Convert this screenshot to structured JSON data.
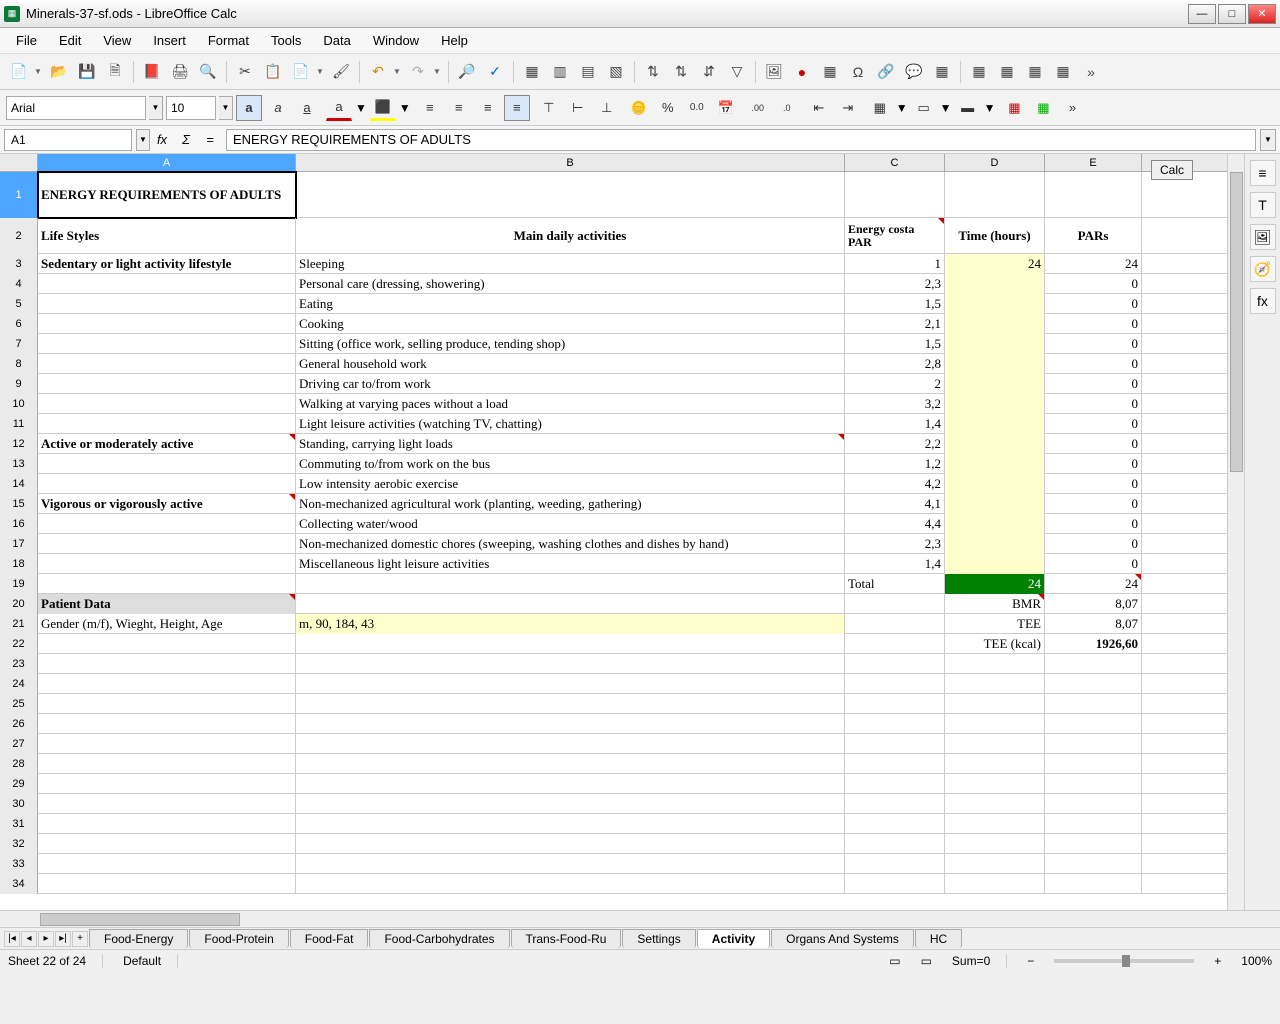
{
  "window": {
    "title": "Minerals-37-sf.ods - LibreOffice Calc"
  },
  "menu": [
    "File",
    "Edit",
    "View",
    "Insert",
    "Format",
    "Tools",
    "Data",
    "Window",
    "Help"
  ],
  "format": {
    "font_name": "Arial",
    "font_size": "10"
  },
  "cellref": {
    "name": "A1",
    "formula": "ENERGY REQUIREMENTS OF ADULTS"
  },
  "columns": [
    "A",
    "B",
    "C",
    "D",
    "E"
  ],
  "calc_button": "Calc",
  "rows": [
    {
      "n": 1,
      "h": "row1",
      "A": "ENERGY REQUIREMENTS OF ADULTS",
      "A_bold": true,
      "A_sel": true
    },
    {
      "n": 2,
      "h": "row2",
      "A": "Life Styles",
      "A_bold": true,
      "B": "Main daily activities",
      "B_bold": true,
      "B_center": true,
      "C": "Energy costa PAR",
      "C_bold": true,
      "C_center": true,
      "C_red": true,
      "D": "Time (hours)",
      "D_bold": true,
      "D_center": true,
      "E": "PARs",
      "E_bold": true,
      "E_center": true
    },
    {
      "n": 3,
      "A": "Sedentary or light activity lifestyle",
      "A_bold": true,
      "B": "Sleeping",
      "C": "1",
      "D": "24",
      "D_yellow": true,
      "E": "24"
    },
    {
      "n": 4,
      "B": "Personal care (dressing, showering)",
      "C": "2,3",
      "D": "",
      "D_yellow": true,
      "E": "0"
    },
    {
      "n": 5,
      "B": "Eating",
      "C": "1,5",
      "D": "",
      "D_yellow": true,
      "E": "0"
    },
    {
      "n": 6,
      "B": "Cooking",
      "C": "2,1",
      "D": "",
      "D_yellow": true,
      "E": "0"
    },
    {
      "n": 7,
      "B": "Sitting (office work, selling produce, tending shop)",
      "C": "1,5",
      "D": "",
      "D_yellow": true,
      "E": "0"
    },
    {
      "n": 8,
      "B": "General household work",
      "C": "2,8",
      "D": "",
      "D_yellow": true,
      "E": "0"
    },
    {
      "n": 9,
      "B": "Driving car to/from work",
      "C": "2",
      "D": "",
      "D_yellow": true,
      "E": "0"
    },
    {
      "n": 10,
      "B": "Walking at varying paces without a load",
      "C": "3,2",
      "D": "",
      "D_yellow": true,
      "E": "0"
    },
    {
      "n": 11,
      "B": "Light leisure activities (watching TV, chatting)",
      "C": "1,4",
      "D": "",
      "D_yellow": true,
      "E": "0"
    },
    {
      "n": 12,
      "A": "Active or moderately active",
      "A_bold": true,
      "A_red": true,
      "B": "Standing, carrying light loads",
      "B_red": true,
      "C": "2,2",
      "D": "",
      "D_yellow": true,
      "E": "0"
    },
    {
      "n": 13,
      "B": "Commuting to/from work on the bus",
      "C": "1,2",
      "D": "",
      "D_yellow": true,
      "E": "0"
    },
    {
      "n": 14,
      "B": "Low intensity aerobic exercise",
      "C": "4,2",
      "D": "",
      "D_yellow": true,
      "E": "0"
    },
    {
      "n": 15,
      "A": "Vigorous or vigorously active",
      "A_bold": true,
      "A_red": true,
      "B": "Non-mechanized agricultural work (planting, weeding, gathering)",
      "C": "4,1",
      "D": "",
      "D_yellow": true,
      "E": "0"
    },
    {
      "n": 16,
      "B": "Collecting water/wood",
      "C": "4,4",
      "D": "",
      "D_yellow": true,
      "E": "0"
    },
    {
      "n": 17,
      "B": "Non-mechanized domestic chores (sweeping, washing clothes and dishes by hand)",
      "C": "2,3",
      "D": "",
      "D_yellow": true,
      "E": "0"
    },
    {
      "n": 18,
      "B": "Miscellaneous light leisure activities",
      "C": "1,4",
      "D": "",
      "D_yellow": true,
      "E": "0"
    },
    {
      "n": 19,
      "C": "Total",
      "C_left": true,
      "D": "24",
      "D_green": true,
      "E": "24",
      "E_red": true
    },
    {
      "n": 20,
      "A": "Patient Data",
      "A_bold": true,
      "A_grey": true,
      "A_red": true,
      "D": "BMR",
      "D_red": true,
      "E": "8,07"
    },
    {
      "n": 21,
      "A": "Gender (m/f), Wieght, Height, Age",
      "B": "m, 90, 184, 43",
      "B_yellow": true,
      "D": "TEE",
      "E": "8,07"
    },
    {
      "n": 22,
      "D": "TEE (kcal)",
      "E": "1926,60",
      "E_bold": true
    },
    {
      "n": 23
    },
    {
      "n": 24
    },
    {
      "n": 25
    },
    {
      "n": 26
    },
    {
      "n": 27
    },
    {
      "n": 28
    },
    {
      "n": 29
    },
    {
      "n": 30
    },
    {
      "n": 31
    },
    {
      "n": 32
    },
    {
      "n": 33
    },
    {
      "n": 34
    }
  ],
  "tabs": [
    "Food-Energy",
    "Food-Protein",
    "Food-Fat",
    "Food-Carbohydrates",
    "Trans-Food-Ru",
    "Settings",
    "Activity",
    "Organs And Systems",
    "HC"
  ],
  "active_tab": "Activity",
  "status": {
    "sheet": "Sheet 22 of 24",
    "style": "Default",
    "sum": "Sum=0",
    "zoom": "100%"
  }
}
